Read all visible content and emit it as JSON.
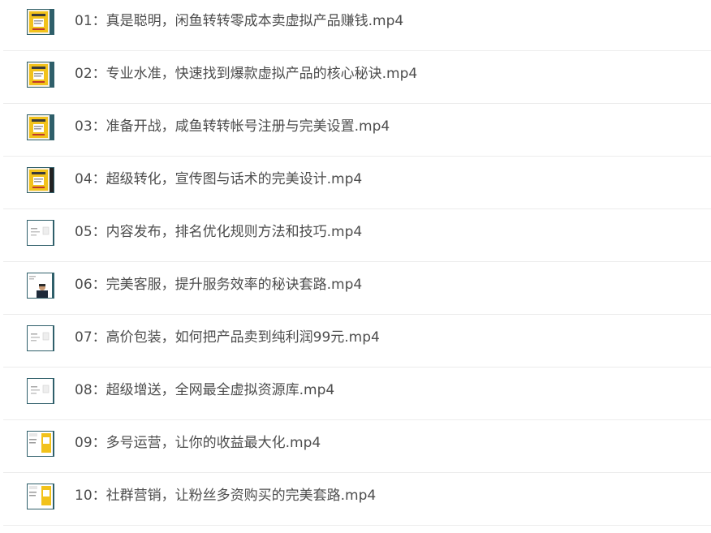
{
  "files": [
    {
      "name": "01：真是聪明，闲鱼转转零成本卖虚拟产品赚钱.mp4",
      "thumbnail": "yellow-poster-thumbnail"
    },
    {
      "name": "02：专业水准，快速找到爆款虚拟产品的核心秘诀.mp4",
      "thumbnail": "yellow-poster-thumbnail"
    },
    {
      "name": "03：准备开战，咸鱼转转帐号注册与完美设置.mp4",
      "thumbnail": "yellow-poster-thumbnail"
    },
    {
      "name": "04：超级转化，宣传图与话术的完美设计.mp4",
      "thumbnail": "yellow-poster-thumbnail"
    },
    {
      "name": "05：内容发布，排名优化规则方法和技巧.mp4",
      "thumbnail": "slide-thumbnail"
    },
    {
      "name": "06：完美客服，提升服务效率的秘诀套路.mp4",
      "thumbnail": "presenter-thumbnail"
    },
    {
      "name": "07：高价包装，如何把产品卖到纯利润99元.mp4",
      "thumbnail": "slide-thumbnail"
    },
    {
      "name": "08：超级增送，全网最全虚拟资源库.mp4",
      "thumbnail": "slide-thumbnail"
    },
    {
      "name": "09：多号运营，让你的收益最大化.mp4",
      "thumbnail": "slide-yellow-thumbnail"
    },
    {
      "name": "10：社群营销，让粉丝多资购买的完美套路.mp4",
      "thumbnail": "slide-yellow-thumbnail"
    }
  ],
  "colors": {
    "text": "#4d4d4d",
    "divider": "#ececec",
    "thumb_frame": "#2f5f6a",
    "thumb_yellow": "#f2c21b"
  }
}
